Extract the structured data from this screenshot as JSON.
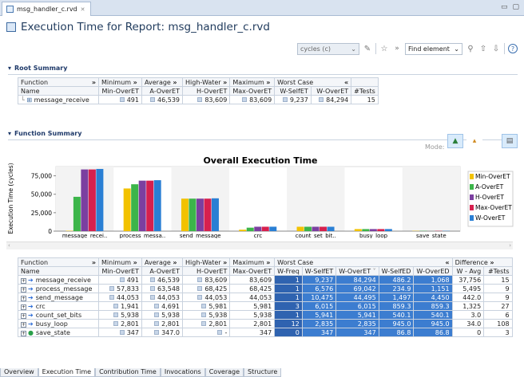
{
  "tab": {
    "label": "msg_handler_c.rvd",
    "close": "✕"
  },
  "window": {
    "min": "▭",
    "max": "▢"
  },
  "page_title": "Execution Time for Report: msg_handler_c.rvd",
  "toolbar": {
    "unit": "cycles (c)",
    "find_placeholder": "Find element",
    "help": "?"
  },
  "root_summary": {
    "title": "Root Summary",
    "groups": [
      "Function",
      "Minimum",
      "Average",
      "High-Water",
      "Maximum",
      "Worst Case",
      ""
    ],
    "columns": [
      "Name",
      "Min-OverET",
      "A-OverET",
      "H-OverET",
      "Max-OverET",
      "W-SelfET",
      "W-OverET",
      "#Tests"
    ],
    "row": {
      "name": "message_receive",
      "min": "491",
      "avg": "46,539",
      "hw": "83,609",
      "max": "83,609",
      "wself": "9,237",
      "wover": "84,294",
      "tests": "15"
    }
  },
  "function_summary": {
    "title": "Function Summary",
    "mode_label": "Mode:"
  },
  "chart_data": {
    "type": "bar",
    "title": "Overall Execution Time",
    "ylabel": "Execution Time (cycles)",
    "ylim": [
      0,
      87500
    ],
    "yticks": [
      "0",
      "25,000",
      "50,000",
      "75,000"
    ],
    "categories": [
      "message_recei..",
      "process_messa..",
      "send_message",
      "crc",
      "count_set_bit..",
      "busy_loop",
      "save_state"
    ],
    "series": [
      {
        "name": "Min-OverET",
        "color": "#f2c200",
        "values": [
          491,
          57833,
          44053,
          1941,
          5938,
          2801,
          347
        ]
      },
      {
        "name": "A-OverET",
        "color": "#3cb54a",
        "values": [
          46539,
          63548,
          44053,
          4691,
          5938,
          2801,
          347
        ]
      },
      {
        "name": "H-OverET",
        "color": "#7b3fa0",
        "values": [
          83609,
          68425,
          44053,
          5981,
          5938,
          2801,
          0
        ]
      },
      {
        "name": "Max-OverET",
        "color": "#d6204e",
        "values": [
          83609,
          68425,
          44053,
          5981,
          5938,
          2801,
          347
        ]
      },
      {
        "name": "W-OverET",
        "color": "#2a7fd4",
        "values": [
          84294,
          69042,
          44495,
          6015,
          5941,
          2835,
          347
        ]
      }
    ],
    "legend": "right"
  },
  "detail": {
    "groups": [
      "Function",
      "Minimum",
      "Average",
      "High-Water",
      "Maximum",
      "Worst Case",
      "Difference"
    ],
    "columns": [
      "Name",
      "Min-OverET",
      "A-OverET",
      "H-OverET",
      "Max-OverET",
      "W-Freq",
      "W-SelfET",
      "W-OverET",
      "W-SelfED",
      "W-OverED",
      "W - Avg",
      "#Tests"
    ],
    "rows": [
      {
        "name": "message_receive",
        "icon": "arrow",
        "min": "491",
        "avg": "46,539",
        "hw": "83,609",
        "max": "83,609",
        "freq": "1",
        "wself": "9,237",
        "wover": "84,294",
        "wselfed": "486.2",
        "wovered": "1,068",
        "wavg": "37,756",
        "tests": "15"
      },
      {
        "name": "process_message",
        "icon": "arrow",
        "min": "57,833",
        "avg": "63,548",
        "hw": "68,425",
        "max": "68,425",
        "freq": "1",
        "wself": "6,576",
        "wover": "69,042",
        "wselfed": "234.9",
        "wovered": "1,151",
        "wavg": "5,495",
        "tests": "9"
      },
      {
        "name": "send_message",
        "icon": "arrow",
        "min": "44,053",
        "avg": "44,053",
        "hw": "44,053",
        "max": "44,053",
        "freq": "1",
        "wself": "10,475",
        "wover": "44,495",
        "wselfed": "1,497",
        "wovered": "4,450",
        "wavg": "442.0",
        "tests": "9"
      },
      {
        "name": "crc",
        "icon": "arrow",
        "min": "1,941",
        "avg": "4,691",
        "hw": "5,981",
        "max": "5,981",
        "freq": "3",
        "wself": "6,015",
        "wover": "6,015",
        "wselfed": "859.3",
        "wovered": "859.3",
        "wavg": "1,325",
        "tests": "27"
      },
      {
        "name": "count_set_bits",
        "icon": "arrow",
        "min": "5,938",
        "avg": "5,938",
        "hw": "5,938",
        "max": "5,938",
        "freq": "1",
        "wself": "5,941",
        "wover": "5,941",
        "wselfed": "540.1",
        "wovered": "540.1",
        "wavg": "3.0",
        "tests": "6"
      },
      {
        "name": "busy_loop",
        "icon": "arrow",
        "min": "2,801",
        "avg": "2,801",
        "hw": "2,801",
        "max": "2,801",
        "freq": "12",
        "wself": "2,835",
        "wover": "2,835",
        "wselfed": "945.0",
        "wovered": "945.0",
        "wavg": "34.0",
        "tests": "108"
      },
      {
        "name": "save_state",
        "icon": "dot",
        "min": "347",
        "avg": "347.0",
        "hw": "-",
        "max": "347",
        "freq": "0",
        "wself": "347",
        "wover": "347",
        "wselfed": "86.8",
        "wovered": "86.8",
        "wavg": "0",
        "tests": "3"
      }
    ]
  },
  "bottom_tabs": [
    "Overview",
    "Execution Time",
    "Contribution Time",
    "Invocations",
    "Coverage",
    "Structure"
  ]
}
